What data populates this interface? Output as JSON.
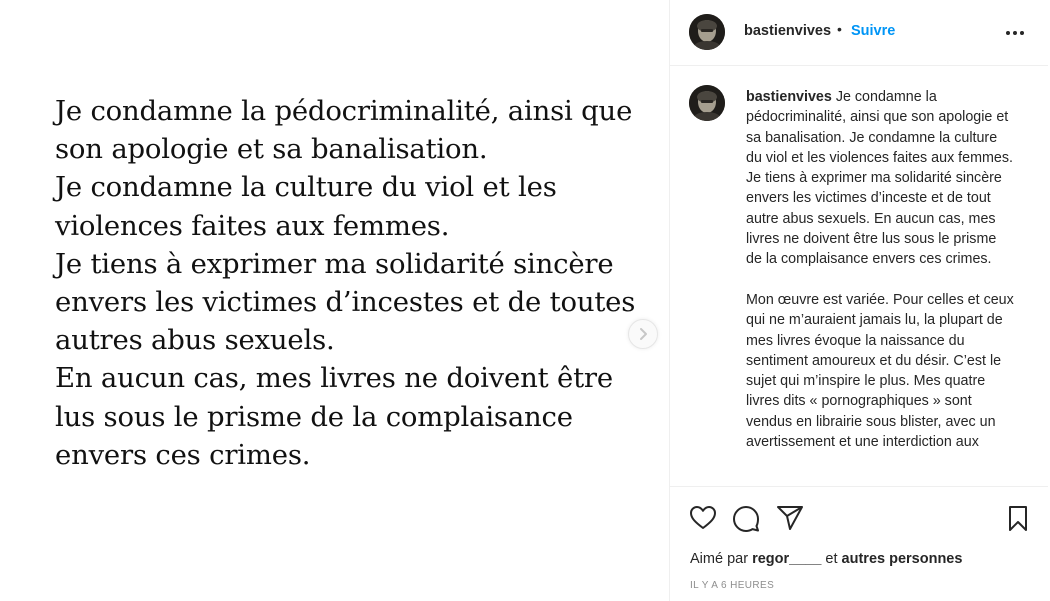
{
  "media": {
    "lines": [
      "Je condamne la pédocriminalité, ainsi que",
      "son apologie et sa banalisation.",
      "Je condamne la culture du viol et les",
      "violences faites aux femmes.",
      "Je tiens à exprimer ma solidarité sincère",
      "envers les victimes d’incestes et de toutes",
      "autres abus sexuels.",
      "En aucun cas, mes livres ne doivent être",
      "lus sous le prisme de la complaisance",
      "envers ces crimes."
    ],
    "next_icon": "chevron-right-icon"
  },
  "header": {
    "username": "bastienvives",
    "separator": "•",
    "follow_label": "Suivre",
    "more_icon": "more-options-icon"
  },
  "caption": {
    "username": "bastienvives",
    "paragraph1": "Je condamne la pédocriminalité, ainsi que son apologie et sa banalisation. Je condamne la culture du viol et les violences faites aux femmes. Je tiens à exprimer ma solidarité sincère envers les victimes d’inceste et de tout autre abus sexuels. En aucun cas, mes livres ne doivent être lus sous le prisme de la complaisance envers ces crimes.",
    "paragraph2": "Mon œuvre est variée. Pour celles et ceux qui ne m’auraient jamais lu, la plupart de mes livres évoque la naissance du sentiment amoureux et du désir. C’est le sujet qui m’inspire le plus. Mes quatre livres dits « pornographiques » sont vendus en librairie sous blister, avec un avertissement et une interdiction aux"
  },
  "actions": {
    "like_icon": "heart-icon",
    "comment_icon": "comment-icon",
    "share_icon": "share-icon",
    "save_icon": "bookmark-icon"
  },
  "likes": {
    "prefix": "Aimé par",
    "user": "regor____",
    "conjunction": "et",
    "others": "autres personnes"
  },
  "timestamp": "IL Y A 6 HEURES",
  "colors": {
    "accent": "#0095f6",
    "text": "#262626",
    "muted": "#8e8e8e",
    "border": "#efefef"
  }
}
